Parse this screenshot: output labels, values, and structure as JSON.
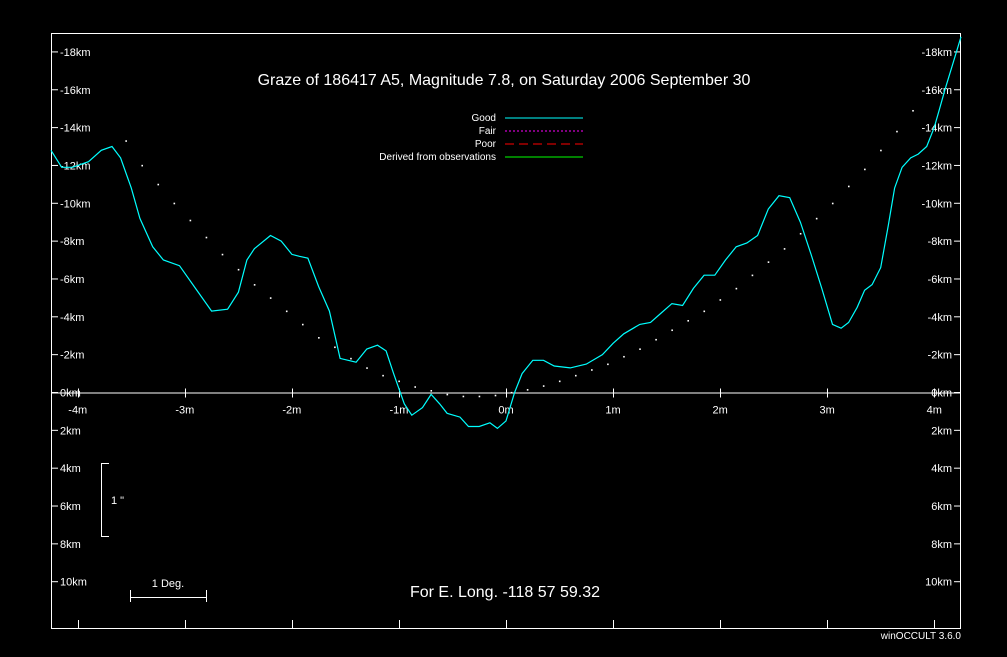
{
  "chart_data": {
    "type": "line",
    "title": "Graze of  186417  A5,  Magnitude  7.8,  on Saturday  2006  September  30",
    "xlim": [
      -4.25,
      4.25
    ],
    "ylim": [
      -19,
      12.5
    ],
    "x_ticks": [
      -4,
      -3,
      -2,
      -1,
      0,
      1,
      2,
      3,
      4
    ],
    "x_tick_labels": [
      "-4m",
      "-3m",
      "-2m",
      "-1m",
      "0m",
      "1m",
      "2m",
      "3m",
      "4m"
    ],
    "y_ticks": [
      -18,
      -16,
      -14,
      -12,
      -10,
      -8,
      -6,
      -4,
      -2,
      0,
      2,
      4,
      6,
      8,
      10
    ],
    "y_tick_labels": [
      "-18km",
      "-16km",
      "-14km",
      "-12km",
      "-10km",
      "-8km",
      "-6km",
      "-4km",
      "-2km",
      "0km",
      "2km",
      "4km",
      "6km",
      "8km",
      "10km"
    ],
    "legend": {
      "position": "top-center",
      "entries": [
        {
          "label": "Good",
          "color": "#00ffff",
          "style": "solid"
        },
        {
          "label": "Fair",
          "color": "#ff00ff",
          "style": "dotted"
        },
        {
          "label": "Poor",
          "color": "#ff0000",
          "style": "dashed"
        },
        {
          "label": "Derived from observations",
          "color": "#00ff00",
          "style": "solid"
        }
      ]
    },
    "series": [
      {
        "color": "#00ffff",
        "x": [
          -4.25,
          -4.15,
          -4.05,
          -3.9,
          -3.78,
          -3.68,
          -3.6,
          -3.5,
          -3.42,
          -3.3,
          -3.2,
          -3.05,
          -2.9,
          -2.75,
          -2.6,
          -2.5,
          -2.42,
          -2.35,
          -2.2,
          -2.1,
          -2.0,
          -1.93,
          -1.85,
          -1.75,
          -1.65,
          -1.55,
          -1.4,
          -1.3,
          -1.2,
          -1.12,
          -1.05,
          -0.95,
          -0.88,
          -0.78,
          -0.7,
          -0.62,
          -0.55,
          -0.43,
          -0.35,
          -0.25,
          -0.15,
          -0.08,
          0.0,
          0.08,
          0.15,
          0.25,
          0.35,
          0.45,
          0.6,
          0.75,
          0.9,
          1.0,
          1.1,
          1.25,
          1.35,
          1.45,
          1.55,
          1.65,
          1.75,
          1.85,
          1.95,
          2.05,
          2.15,
          2.25,
          2.35,
          2.45,
          2.55,
          2.65,
          2.75,
          2.85,
          2.95,
          3.05,
          3.13,
          3.2,
          3.28,
          3.35,
          3.42,
          3.5,
          3.57,
          3.63,
          3.7,
          3.78,
          3.85,
          3.93,
          4.0,
          4.05,
          4.1,
          4.17,
          4.25
        ],
        "y": [
          -12.8,
          -11.9,
          -11.9,
          -12.2,
          -12.8,
          -13.0,
          -12.4,
          -10.8,
          -9.2,
          -7.7,
          -7.0,
          -6.7,
          -5.5,
          -4.3,
          -4.4,
          -5.3,
          -7.0,
          -7.6,
          -8.3,
          -8.0,
          -7.3,
          -7.2,
          -7.1,
          -5.6,
          -4.3,
          -1.8,
          -1.6,
          -2.3,
          -2.5,
          -2.2,
          -1.0,
          0.6,
          1.2,
          0.8,
          0.1,
          0.6,
          1.1,
          1.3,
          1.8,
          1.8,
          1.6,
          1.9,
          1.5,
          0.0,
          -1.0,
          -1.7,
          -1.7,
          -1.4,
          -1.3,
          -1.5,
          -2.0,
          -2.6,
          -3.1,
          -3.6,
          -3.7,
          -4.2,
          -4.7,
          -4.6,
          -5.5,
          -6.2,
          -6.2,
          -7.0,
          -7.7,
          -7.9,
          -8.3,
          -9.7,
          -10.4,
          -10.3,
          -9.0,
          -7.3,
          -5.5,
          -3.6,
          -3.4,
          -3.7,
          -4.5,
          -5.4,
          -5.7,
          -6.6,
          -8.8,
          -10.8,
          -11.9,
          -12.4,
          -12.6,
          -13.0,
          -14.0,
          -15.0,
          -16.0,
          -17.3,
          -18.8
        ]
      },
      {
        "style": "dots",
        "x": [
          -3.55,
          -3.4,
          -3.25,
          -3.1,
          -2.95,
          -2.8,
          -2.65,
          -2.5,
          -2.35,
          -2.2,
          -2.05,
          -1.9,
          -1.75,
          -1.6,
          -1.45,
          -1.3,
          -1.15,
          -1.0,
          -0.85,
          -0.7,
          -0.55,
          -0.4,
          -0.25,
          -0.1,
          0.05,
          0.2,
          0.35,
          0.5,
          0.65,
          0.8,
          0.95,
          1.1,
          1.25,
          1.4,
          1.55,
          1.7,
          1.85,
          2.0,
          2.15,
          2.3,
          2.45,
          2.6,
          2.75,
          2.9,
          3.05,
          3.2,
          3.35,
          3.5,
          3.65,
          3.8,
          3.95
        ],
        "y": [
          -13.3,
          -12.0,
          -11.0,
          -10.0,
          -9.1,
          -8.2,
          -7.3,
          -6.5,
          -5.7,
          -5.0,
          -4.3,
          -3.6,
          -2.9,
          -2.4,
          -1.8,
          -1.3,
          -0.9,
          -0.6,
          -0.3,
          -0.1,
          0.1,
          0.2,
          0.2,
          0.15,
          0.0,
          -0.15,
          -0.35,
          -0.6,
          -0.9,
          -1.2,
          -1.5,
          -1.9,
          -2.3,
          -2.8,
          -3.3,
          -3.8,
          -4.3,
          -4.9,
          -5.5,
          -6.2,
          -6.9,
          -7.6,
          -8.4,
          -9.2,
          -10.0,
          -10.9,
          -11.8,
          -12.8,
          -13.8,
          -14.9,
          -16.0
        ]
      }
    ],
    "annotations": {
      "scale_bar_arcsec_label": "1 \"",
      "scale_bar_deg_label": "1 Deg.",
      "longitude_label": "For E. Long. -118 57 59.32",
      "software_label": "winOCCULT 3.6.0"
    }
  }
}
